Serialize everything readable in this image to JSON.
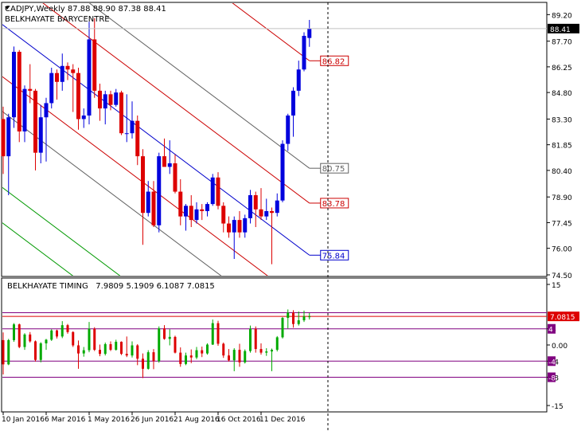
{
  "main_header": "CADJPY,Weekly  87.88 88.90 87.38 88.41",
  "indicator_name": "BELKHAYATE BARYCENTRE",
  "sub_header": "BELKHAYATE TIMING   7.9809 5.1909 6.1087 7.0815",
  "colors": {
    "bull": "#0000dd",
    "bear": "#dd0000",
    "band_inner": "#cc0000",
    "band_mid": "#606060",
    "band_outer": "#009900",
    "center": "#0000cc",
    "hline": "#800080",
    "badge_bg": "#dd0000"
  },
  "chart_data": [
    {
      "type": "candlestick",
      "title": "CADJPY,Weekly",
      "ohlc_last": {
        "open": 87.88,
        "high": 88.9,
        "low": 87.38,
        "close": 88.41
      },
      "ylim": [
        74.5,
        89.8
      ],
      "y_ticks": [
        "89.20",
        "87.70",
        "86.25",
        "84.80",
        "83.30",
        "81.85",
        "80.40",
        "78.90",
        "77.45",
        "76.00",
        "74.50"
      ],
      "y_tick_values": [
        89.2,
        87.7,
        86.25,
        84.8,
        83.3,
        81.85,
        80.4,
        78.9,
        77.45,
        76.0,
        74.5
      ],
      "current_price": "88.41",
      "x_labels": [
        "10 Jan 2016",
        "6 Mar 2016",
        "1 May 2016",
        "26 Jun 2016",
        "21 Aug 2016",
        "16 Oct 2016",
        "11 Dec 2016"
      ],
      "bar_count": 64,
      "candles": [
        [
          83.3,
          84.0,
          80.2,
          81.2
        ],
        [
          81.2,
          83.6,
          79.0,
          83.4
        ],
        [
          83.4,
          87.4,
          82.8,
          87.1
        ],
        [
          87.1,
          87.2,
          82.0,
          82.6
        ],
        [
          82.6,
          85.2,
          82.0,
          85.0
        ],
        [
          85.0,
          86.4,
          84.2,
          84.9
        ],
        [
          84.9,
          85.0,
          80.4,
          81.4
        ],
        [
          81.4,
          84.1,
          80.8,
          83.4
        ],
        [
          83.4,
          84.5,
          80.9,
          84.2
        ],
        [
          84.2,
          86.2,
          83.9,
          85.9
        ],
        [
          85.9,
          86.1,
          84.4,
          85.4
        ],
        [
          85.4,
          87.0,
          84.9,
          86.3
        ],
        [
          86.3,
          86.5,
          85.5,
          86.1
        ],
        [
          86.1,
          86.4,
          83.7,
          85.9
        ],
        [
          85.9,
          86.2,
          82.7,
          83.3
        ],
        [
          83.3,
          83.9,
          82.8,
          83.5
        ],
        [
          83.5,
          88.8,
          83.0,
          87.8
        ],
        [
          87.8,
          89.0,
          84.5,
          84.9
        ],
        [
          84.9,
          85.3,
          83.2,
          83.9
        ],
        [
          83.9,
          84.9,
          83.0,
          84.7
        ],
        [
          84.7,
          84.9,
          83.8,
          84.1
        ],
        [
          84.1,
          85.0,
          84.0,
          84.8
        ],
        [
          84.8,
          84.9,
          82.4,
          82.5
        ],
        [
          82.5,
          84.7,
          82.0,
          82.5
        ],
        [
          82.5,
          84.3,
          82.2,
          83.2
        ],
        [
          83.2,
          83.5,
          80.7,
          81.2
        ],
        [
          81.2,
          81.6,
          76.2,
          78.0
        ],
        [
          78.0,
          79.8,
          77.8,
          79.2
        ],
        [
          79.2,
          79.8,
          77.2,
          77.3
        ],
        [
          77.3,
          81.4,
          76.9,
          81.2
        ],
        [
          81.2,
          82.2,
          80.6,
          80.6
        ],
        [
          80.6,
          82.1,
          80.2,
          80.8
        ],
        [
          80.8,
          81.3,
          79.1,
          79.2
        ],
        [
          79.2,
          79.9,
          77.3,
          77.8
        ],
        [
          77.8,
          78.5,
          77.0,
          78.4
        ],
        [
          78.4,
          79.0,
          77.2,
          77.6
        ],
        [
          77.6,
          78.6,
          77.4,
          78.2
        ],
        [
          78.2,
          78.5,
          77.6,
          78.1
        ],
        [
          78.1,
          78.6,
          77.8,
          78.5
        ],
        [
          78.5,
          80.2,
          78.4,
          80.0
        ],
        [
          80.0,
          80.3,
          78.2,
          78.4
        ],
        [
          78.4,
          78.6,
          76.9,
          77.4
        ],
        [
          77.4,
          77.8,
          76.6,
          76.9
        ],
        [
          76.9,
          77.8,
          75.4,
          77.6
        ],
        [
          77.6,
          78.1,
          76.6,
          76.9
        ],
        [
          76.9,
          77.9,
          76.6,
          77.7
        ],
        [
          77.7,
          79.3,
          77.4,
          79.0
        ],
        [
          79.0,
          79.2,
          77.2,
          78.2
        ],
        [
          78.2,
          79.4,
          77.6,
          77.8
        ],
        [
          77.8,
          78.8,
          77.6,
          78.1
        ],
        [
          78.1,
          78.3,
          75.1,
          78.0
        ],
        [
          78.0,
          79.1,
          77.8,
          78.7
        ],
        [
          78.7,
          82.1,
          78.6,
          81.9
        ],
        [
          81.9,
          83.6,
          81.5,
          83.5
        ],
        [
          83.5,
          85.1,
          82.3,
          84.9
        ],
        [
          84.9,
          86.6,
          84.6,
          86.1
        ],
        [
          86.1,
          88.2,
          86.0,
          88.0
        ],
        [
          87.88,
          88.9,
          87.38,
          88.41
        ]
      ],
      "center_line": [
        {
          "bar": 0,
          "price": 88.6
        },
        {
          "bar": 56,
          "price": 75.84
        }
      ],
      "bands": [
        {
          "color_key": "band_inner",
          "offset": 2.94,
          "label": "83.78"
        },
        {
          "color_key": "band_inner",
          "offset": -2.94,
          "label": ""
        },
        {
          "color_key": "band_mid",
          "offset": -4.91,
          "label": ""
        },
        {
          "color_key": "band_mid",
          "offset": 4.91,
          "label": "80.75"
        },
        {
          "color_key": "band_inner",
          "offset": 10.98,
          "label": "86.82"
        },
        {
          "color_key": "band_outer",
          "offset": -9.2,
          "label": ""
        },
        {
          "color_key": "band_outer",
          "offset": -11.2,
          "label": ""
        }
      ],
      "center_label": "75.84"
    },
    {
      "type": "oscillator",
      "title": "BELKHAYATE TIMING",
      "values": [
        7.9809,
        5.1909,
        6.1087,
        7.0815
      ],
      "ylim": [
        -15,
        15
      ],
      "y_ticks": [
        "15",
        "4",
        "0.00",
        "-4",
        "-8",
        "-15"
      ],
      "y_tick_values": [
        15,
        4,
        0,
        -4,
        -8,
        -15
      ],
      "levels": [
        8,
        4,
        -4,
        -8
      ],
      "level_labels": [
        "8",
        "4",
        "-4",
        "-8"
      ],
      "current": "7.0815",
      "bars": [
        [
          1.2,
          3.1,
          -7.3,
          -4.8
        ],
        [
          -4.8,
          1.5,
          -5.0,
          1.2
        ],
        [
          1.2,
          5.4,
          0.8,
          5.1
        ],
        [
          5.1,
          5.3,
          -0.8,
          -0.5
        ],
        [
          -0.5,
          2.9,
          -1.2,
          2.6
        ],
        [
          2.6,
          3.2,
          0.6,
          0.9
        ],
        [
          0.9,
          1.1,
          -4.1,
          -3.7
        ],
        [
          -3.7,
          0.7,
          -4.3,
          0.4
        ],
        [
          0.4,
          1.5,
          -1.2,
          1.3
        ],
        [
          1.3,
          3.9,
          1.0,
          3.6
        ],
        [
          3.6,
          3.8,
          1.6,
          2.1
        ],
        [
          2.1,
          5.9,
          1.7,
          4.9
        ],
        [
          4.9,
          5.2,
          2.8,
          3.2
        ],
        [
          3.2,
          3.4,
          -0.5,
          -0.1
        ],
        [
          -0.1,
          1.1,
          -5.9,
          -2.1
        ],
        [
          -2.1,
          -0.5,
          -2.9,
          -1.3
        ],
        [
          -1.3,
          5.7,
          -1.8,
          4.0
        ],
        [
          4.0,
          4.4,
          -1.5,
          -1.2
        ],
        [
          -1.2,
          0.1,
          -2.8,
          -2.2
        ],
        [
          -2.2,
          0.6,
          -2.6,
          0.2
        ],
        [
          0.2,
          0.9,
          -1.5,
          -1.2
        ],
        [
          -1.2,
          1.3,
          -1.4,
          0.8
        ],
        [
          0.8,
          0.9,
          -2.5,
          -2.2
        ],
        [
          -2.2,
          2.1,
          -3.0,
          -2.6
        ],
        [
          -2.6,
          0.9,
          -3.1,
          -0.1
        ],
        [
          -0.1,
          0.2,
          -5.0,
          -3.4
        ],
        [
          -3.4,
          -2.1,
          -8.2,
          -5.9
        ],
        [
          -5.9,
          -1.3,
          -6.1,
          -1.8
        ],
        [
          -1.8,
          -1.0,
          -6.0,
          -4.0
        ],
        [
          -4.0,
          4.6,
          -4.4,
          4.1
        ],
        [
          4.1,
          4.9,
          1.3,
          1.5
        ],
        [
          1.5,
          3.9,
          -0.1,
          2.0
        ],
        [
          2.0,
          2.3,
          -2.1,
          -1.9
        ],
        [
          -1.9,
          -0.6,
          -5.4,
          -4.7
        ],
        [
          -4.7,
          -1.9,
          -5.0,
          -2.6
        ],
        [
          -2.6,
          -1.1,
          -4.5,
          -3.1
        ],
        [
          -3.1,
          -0.5,
          -3.5,
          -1.3
        ],
        [
          -1.3,
          -0.4,
          -3.0,
          -2.1
        ],
        [
          -2.1,
          0.4,
          -2.4,
          0.1
        ],
        [
          0.1,
          6.3,
          0.0,
          5.4
        ],
        [
          5.4,
          6.0,
          -0.2,
          0.3
        ],
        [
          0.3,
          0.6,
          -3.2,
          -2.6
        ],
        [
          -2.6,
          -1.0,
          -4.1,
          -3.8
        ],
        [
          -3.8,
          -0.8,
          -6.5,
          -1.2
        ],
        [
          -1.2,
          0.3,
          -5.4,
          -4.3
        ],
        [
          -4.3,
          -1.1,
          -4.6,
          -1.5
        ],
        [
          -1.5,
          4.8,
          -1.9,
          4.0
        ],
        [
          4.0,
          4.6,
          -1.9,
          -1.0
        ],
        [
          -1.0,
          0.4,
          -2.4,
          -1.9
        ],
        [
          -1.9,
          -0.8,
          -2.7,
          -1.6
        ],
        [
          -1.6,
          -0.9,
          -6.5,
          -1.2
        ],
        [
          -1.2,
          2.2,
          -1.6,
          1.9
        ],
        [
          1.9,
          6.9,
          1.6,
          6.7
        ],
        [
          6.7,
          8.8,
          4.1,
          7.98
        ],
        [
          7.98,
          8.6,
          4.3,
          5.19
        ],
        [
          5.19,
          8.3,
          4.8,
          6.11
        ],
        [
          6.11,
          8.5,
          5.7,
          7.08
        ],
        [
          7.08,
          7.9,
          6.3,
          7.08
        ]
      ]
    }
  ]
}
